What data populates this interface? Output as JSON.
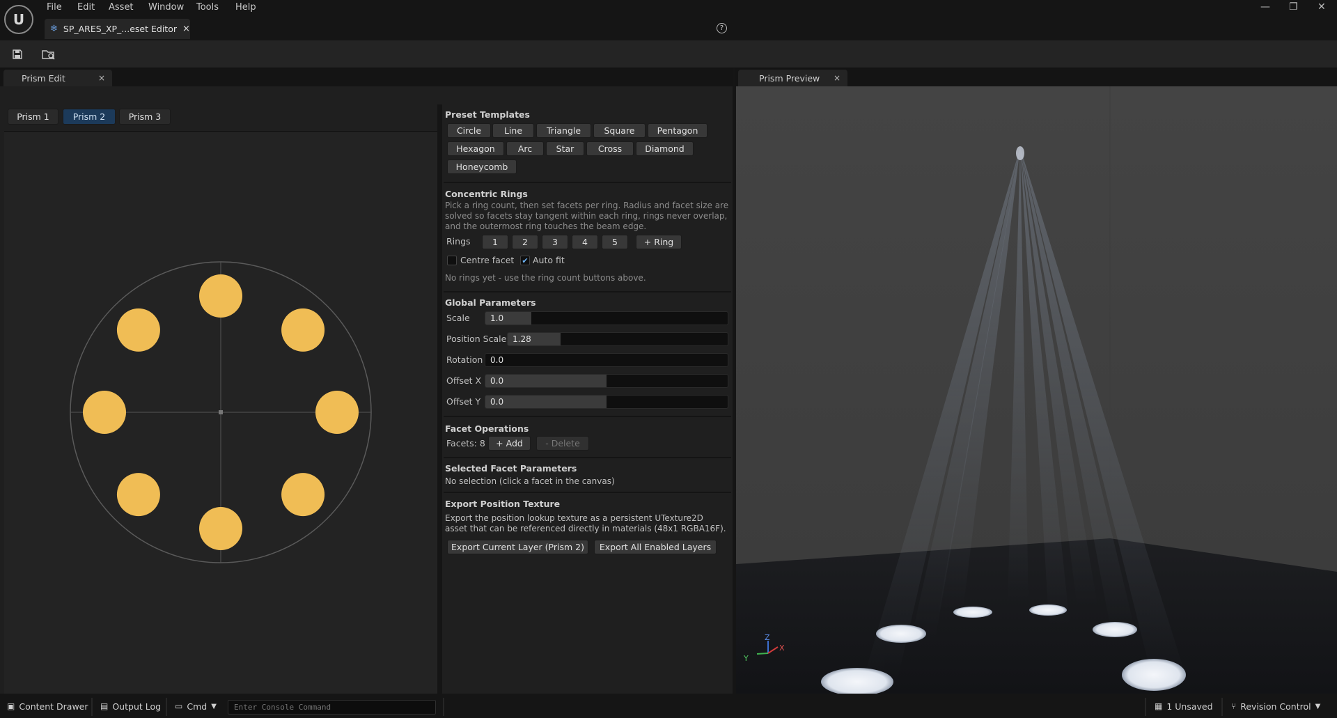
{
  "menu": [
    "File",
    "Edit",
    "Asset",
    "Window",
    "Tools",
    "Help"
  ],
  "document_tab": {
    "label": "SP_ARES_XP_...eset Editor",
    "close": "×"
  },
  "window_controls": {
    "minimize": "—",
    "restore": "❐",
    "close": "✕"
  },
  "left_tab": {
    "label": "Prism Edit",
    "close": "×"
  },
  "right_tab": {
    "label": "Prism Preview",
    "close": "×"
  },
  "prism_tabs": [
    "Prism 1",
    "Prism 2",
    "Prism 3"
  ],
  "active_prism": "Prism 2",
  "canvas": {
    "facet_color": "#f0bd55",
    "facet_count": 8,
    "facet_angles_deg": [
      90,
      45,
      0,
      -45,
      -90,
      -135,
      180,
      135
    ]
  },
  "preset_templates": {
    "title": "Preset Templates",
    "buttons": [
      "Circle",
      "Line",
      "Triangle",
      "Square",
      "Pentagon",
      "Hexagon",
      "Arc",
      "Star",
      "Cross",
      "Diamond",
      "Honeycomb"
    ]
  },
  "concentric_rings": {
    "title": "Concentric Rings",
    "description": "Pick a ring count, then set facets per ring. Radius and facet size are solved so facets stay tangent within each ring, rings never overlap, and the outermost ring touches the beam edge.",
    "rings_label": "Rings",
    "ring_buttons": [
      "1",
      "2",
      "3",
      "4",
      "5"
    ],
    "add_ring": "+ Ring",
    "centre_facet": {
      "label": "Centre facet",
      "checked": false
    },
    "auto_fit": {
      "label": "Auto fit",
      "checked": true
    },
    "empty_text": "No rings yet - use the ring count buttons above."
  },
  "global_parameters": {
    "title": "Global Parameters",
    "fields": [
      {
        "label": "Scale",
        "value": "1.0",
        "fill": 0.19
      },
      {
        "label": "Position Scale",
        "value": "1.28",
        "fill": 0.24
      },
      {
        "label": "Rotation",
        "value": "0.0",
        "fill": 0.0
      },
      {
        "label": "Offset X",
        "value": "0.0",
        "fill": 0.5
      },
      {
        "label": "Offset Y",
        "value": "0.0",
        "fill": 0.5
      }
    ]
  },
  "facet_operations": {
    "title": "Facet Operations",
    "count_label": "Facets: 8",
    "add": "+ Add",
    "delete": "- Delete"
  },
  "selected_facet": {
    "title": "Selected Facet Parameters",
    "text": "No selection (click a facet in the canvas)"
  },
  "export": {
    "title": "Export Position Texture",
    "description": "Export the position lookup texture as a persistent UTexture2D asset that can be referenced directly in materials (48x1 RGBA16F).",
    "current_layer": "Export Current Layer (Prism 2)",
    "all_layers": "Export All Enabled Layers"
  },
  "viewport_axes": {
    "z": "Z",
    "y": "Y",
    "x": "X"
  },
  "statusbar": {
    "content_drawer": "Content Drawer",
    "output_log": "Output Log",
    "cmd": "Cmd",
    "console_placeholder": "Enter Console Command",
    "unsaved": "1 Unsaved",
    "revision_control": "Revision Control"
  }
}
